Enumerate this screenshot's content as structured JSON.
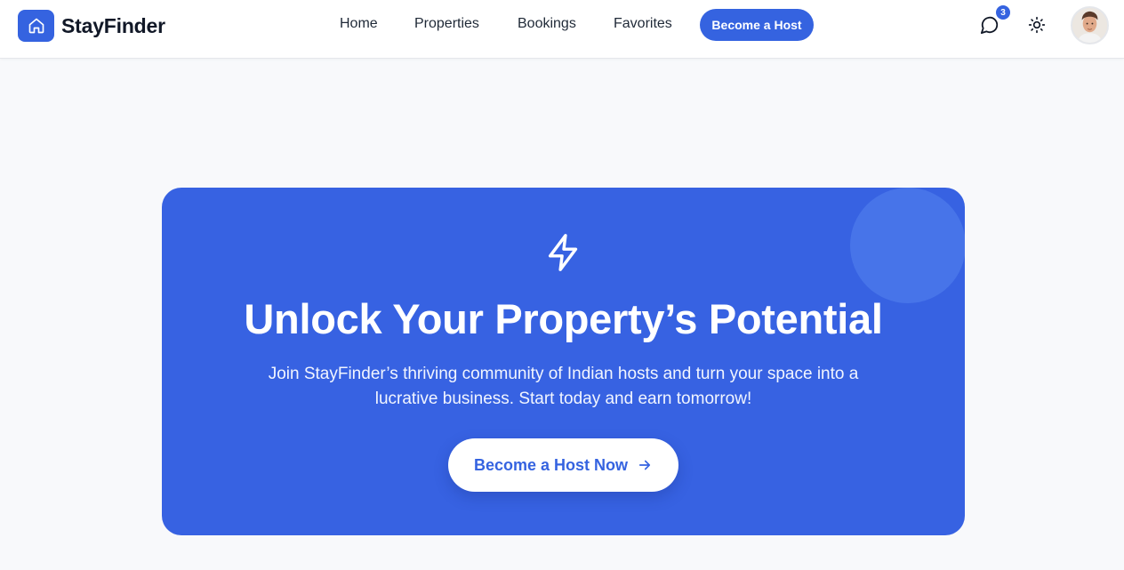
{
  "brand": {
    "name": "StayFinder",
    "logo_icon": "home-icon"
  },
  "nav": {
    "links": [
      "Home",
      "Properties",
      "Bookings",
      "Favorites"
    ],
    "host_button": "Become a Host"
  },
  "header_actions": {
    "messages_icon": "message-circle-icon",
    "messages_badge": "3",
    "theme_icon": "sun-icon"
  },
  "hero": {
    "icon": "lightning-bolt-icon",
    "title": "Unlock Your Property’s Potential",
    "subtitle": "Join StayFinder’s thriving community of Indian hosts and turn your space into a lucrative business. Start today and earn tomorrow!",
    "cta_label": "Become a Host Now",
    "cta_icon": "arrow-right-icon"
  },
  "colors": {
    "accent": "#3563e0",
    "hero_bg": "#3762e2",
    "page_bg": "#f8f9fb"
  }
}
